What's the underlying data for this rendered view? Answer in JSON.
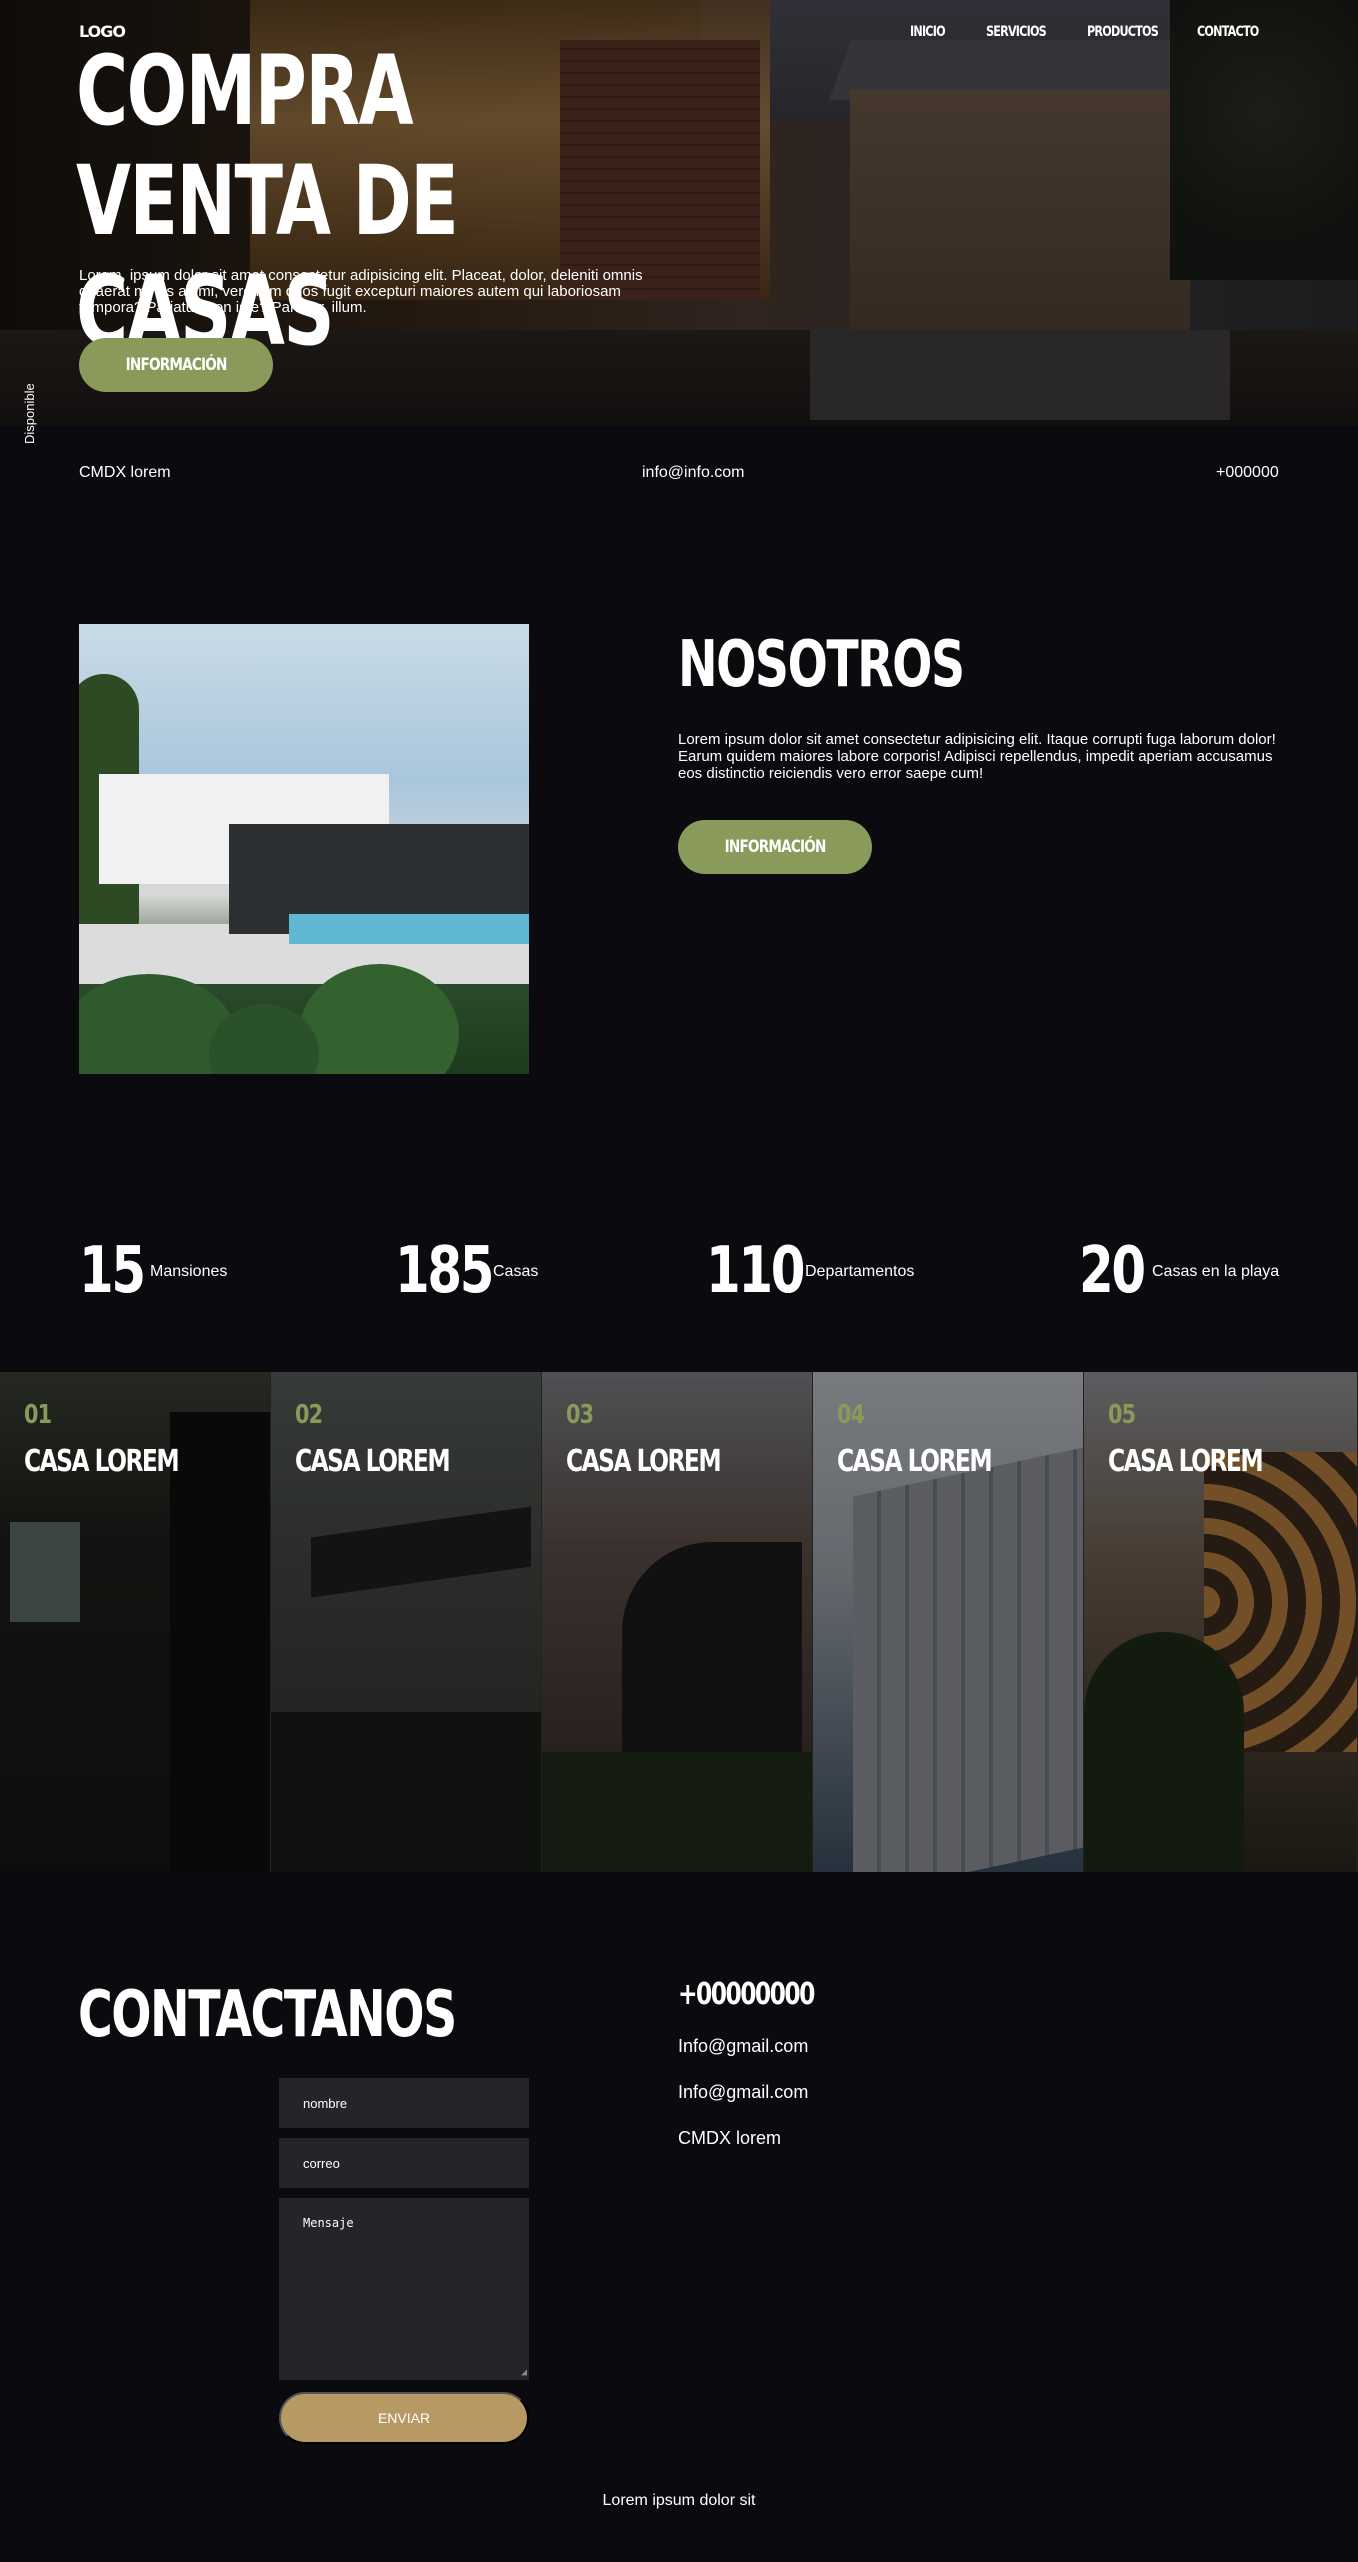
{
  "header": {
    "logo": "LOGO",
    "nav": [
      "INICIO",
      "SERVICIOS",
      "PRODUCTOS",
      "CONTACTO"
    ]
  },
  "hero": {
    "title": "COMPRA VENTA DE CASAS",
    "description": "Lorem, ipsum dolor sit amet consectetur adipisicing elit. Placeat, dolor, deleniti omnis quaerat minus animi, vero rem quos fugit excepturi maiores autem qui laboriosam tempora? Pariatur, non iste? Pariatur, illum.",
    "button": "INFORMACIÓN",
    "vertical_label": "Disponible"
  },
  "info_bar": {
    "address": "CMDX lorem",
    "email": "info@info.com",
    "phone": "+000000"
  },
  "about": {
    "title": "NOSOTROS",
    "description": "Lorem ipsum dolor sit amet consectetur adipisicing elit. Itaque corrupti fuga laborum dolor! Earum quidem maiores labore corporis! Adipisci repellendus, impedit aperiam accusamus eos distinctio reiciendis vero error saepe cum!",
    "button": "INFORMACIÓN"
  },
  "stats": [
    {
      "number": "15",
      "label": "Mansiones"
    },
    {
      "number": "185",
      "label": "Casas"
    },
    {
      "number": "110",
      "label": "Departamentos"
    },
    {
      "number": "20",
      "label": "Casas en la playa"
    }
  ],
  "gallery": [
    {
      "number": "01",
      "title": "CASA LOREM"
    },
    {
      "number": "02",
      "title": "CASA LOREM"
    },
    {
      "number": "03",
      "title": "CASA LOREM"
    },
    {
      "number": "04",
      "title": "CASA LOREM"
    },
    {
      "number": "05",
      "title": "CASA LOREM"
    }
  ],
  "contact": {
    "title": "CONTACTANOS",
    "name_placeholder": "nombre",
    "email_placeholder": "correo",
    "message_placeholder": "Mensaje",
    "send_button": "ENVIAR",
    "phone": "+00000000",
    "email1": "Info@gmail.com",
    "email2": "Info@gmail.com",
    "address": "CMDX lorem"
  },
  "footer": {
    "text": "Lorem ipsum dolor sit"
  },
  "colors": {
    "background": "#0b0b0f",
    "accent_olive": "#8a9a5b",
    "accent_gold": "#b79a63",
    "input_bg": "#252429"
  }
}
